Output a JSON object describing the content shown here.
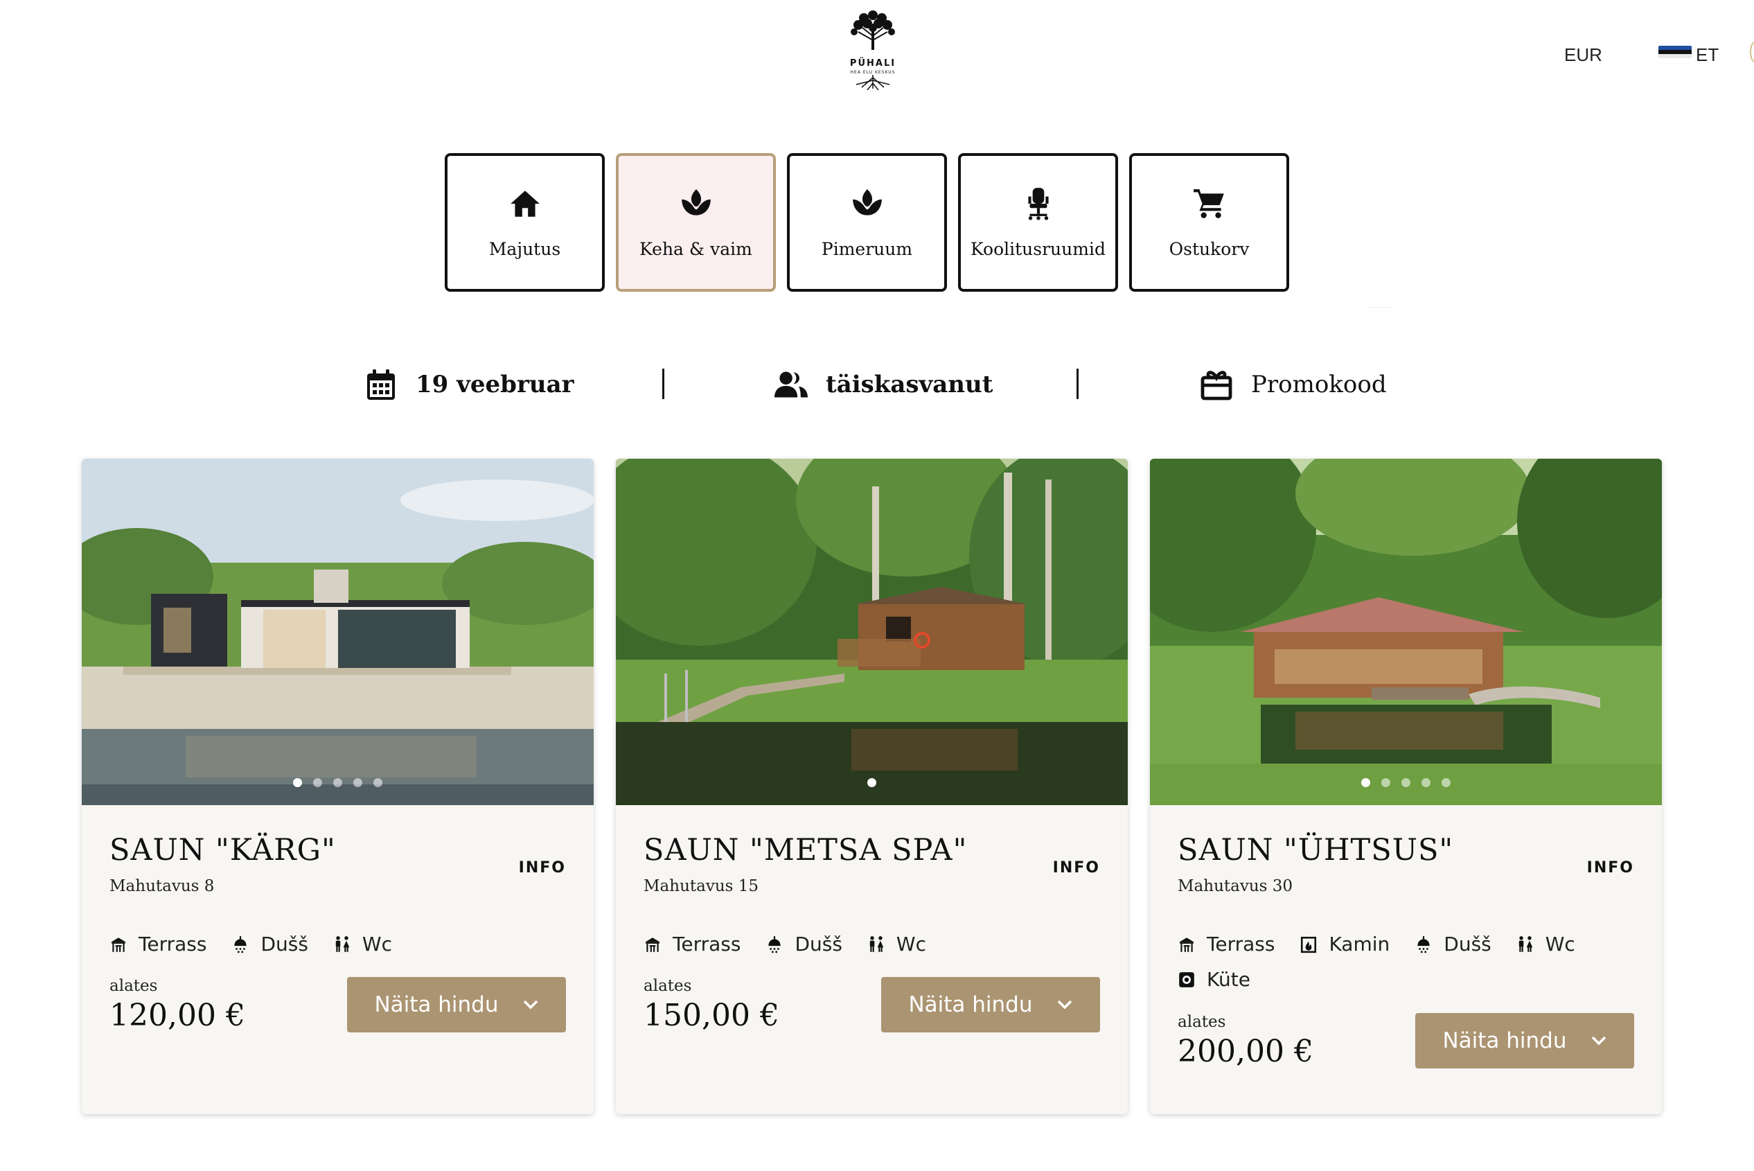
{
  "brand": {
    "name": "PÜHALI",
    "tagline": "HEA ELU KESKUS"
  },
  "header": {
    "currency": "EUR",
    "language": "ET"
  },
  "tabs": [
    {
      "label": "Majutus",
      "icon": "home-icon",
      "active": false
    },
    {
      "label": "Keha & vaim",
      "icon": "lotus-icon",
      "active": true
    },
    {
      "label": "Pimeruum",
      "icon": "lotus-icon",
      "active": false
    },
    {
      "label": "Koolitusruumid",
      "icon": "office-chair-icon",
      "active": false
    },
    {
      "label": "Ostukorv",
      "icon": "cart-icon",
      "active": false
    }
  ],
  "filters": {
    "date": "19 veebruar",
    "guests": "täiskasvanut",
    "promo": "Promokood"
  },
  "cards": [
    {
      "title": "SAUN \"KÄRG\"",
      "info": "INFO",
      "capacity": "Mahutavus 8",
      "features": [
        "Terrass",
        "Dušš",
        "Wc"
      ],
      "price_from": "alates",
      "price": "120,00 €",
      "button": "Näita hindu"
    },
    {
      "title": "SAUN \"METSA SPA\"",
      "info": "INFO",
      "capacity": "Mahutavus 15",
      "features": [
        "Terrass",
        "Dušš",
        "Wc"
      ],
      "price_from": "alates",
      "price": "150,00 €",
      "button": "Näita hindu"
    },
    {
      "title": "SAUN \"ÜHTSUS\"",
      "info": "INFO",
      "capacity": "Mahutavus 30",
      "features": [
        "Terrass",
        "Kamin",
        "Dušš",
        "Wc",
        "Küte"
      ],
      "price_from": "alates",
      "price": "200,00 €",
      "button": "Näita hindu"
    }
  ],
  "colors": {
    "accent": "#ab9472",
    "active_tab_bg": "#fbeff0",
    "card_bg": "#f8f6f3"
  }
}
